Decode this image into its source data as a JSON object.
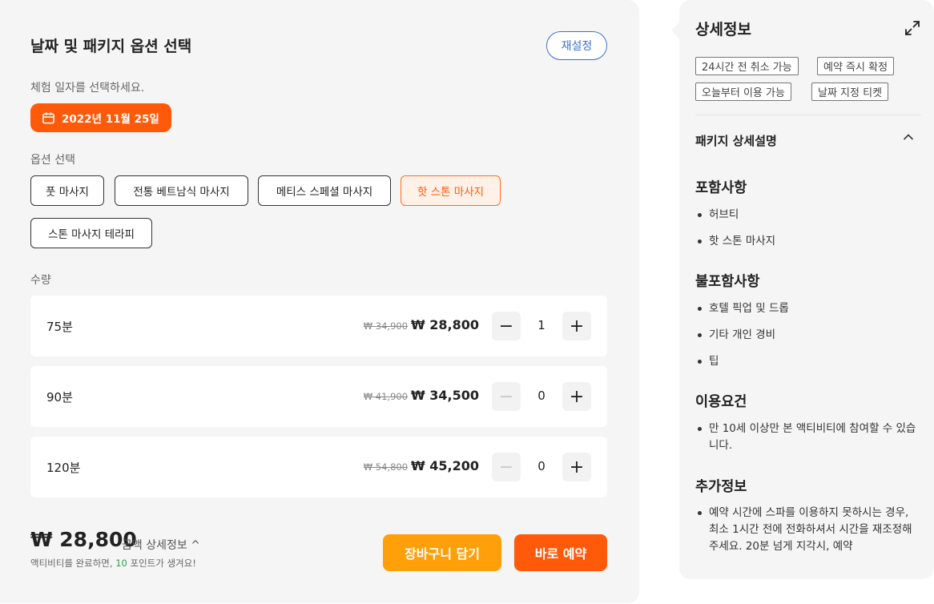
{
  "booking": {
    "title": "날짜 및 패키지 옵션 선택",
    "reset_label": "재설정",
    "date_prompt": "체험 일자를 선택하세요.",
    "selected_date": "2022년 11월 25일",
    "option_label": "옵션 선택",
    "options": [
      {
        "label": "풋 마사지",
        "selected": false
      },
      {
        "label": "전통 베트남식 마사지",
        "selected": false
      },
      {
        "label": "메티스 스페셜 마사지",
        "selected": false
      },
      {
        "label": "핫 스톤 마사지",
        "selected": true
      },
      {
        "label": "스톤 마사지 테라피",
        "selected": false
      }
    ],
    "quantity_label": "수량",
    "quantities": [
      {
        "name": "75분",
        "old_price": "₩ 34,900",
        "price": "₩ 28,800",
        "count": "1",
        "minus_enabled": true
      },
      {
        "name": "90분",
        "old_price": "₩ 41,900",
        "price": "₩ 34,500",
        "count": "0",
        "minus_enabled": false
      },
      {
        "name": "120분",
        "old_price": "₩ 54,800",
        "price": "₩ 45,200",
        "count": "0",
        "minus_enabled": false
      }
    ],
    "total_price": "₩ 28,800",
    "total_detail": "금액 상세정보 ^",
    "points_prefix": "액티비티를 완료하면, ",
    "points_value": "10",
    "points_suffix": " 포인트가 생겨요!",
    "cart_label": "장바구니 담기",
    "book_label": "바로 예약"
  },
  "details": {
    "title": "상세정보",
    "tags": [
      "24시간 전 취소 가능",
      "예약 즉시 확정",
      "오늘부터 이용 가능",
      "날짜 지정 티켓"
    ],
    "package_title": "패키지 상세설명",
    "sections": [
      {
        "heading": "포함사항",
        "items": [
          "허브티",
          "핫 스톤 마사지"
        ]
      },
      {
        "heading": "불포함사항",
        "items": [
          "호텔 픽업 및 드롭",
          "기타 개인 경비",
          "팁"
        ]
      },
      {
        "heading": "이용요건",
        "items": [
          "만 10세 이상만 본 액티비티에 참여할 수 있습니다."
        ]
      },
      {
        "heading": "추가정보",
        "items": [
          "예약 시간에 스파를 이용하지 못하시는 경우, 최소 1시간 전에 전화하셔서 시간을 재조정해주세요. 20분 넘게 지각시, 예약"
        ]
      }
    ]
  },
  "colors": {
    "accent": "#ff5a0a",
    "cart": "#ff9f0a",
    "reset": "#3b6fd4",
    "points": "#2aa14a"
  },
  "icons": [
    "calendar-icon",
    "minus-icon",
    "plus-icon",
    "expand-icon",
    "chevron-up-icon"
  ]
}
